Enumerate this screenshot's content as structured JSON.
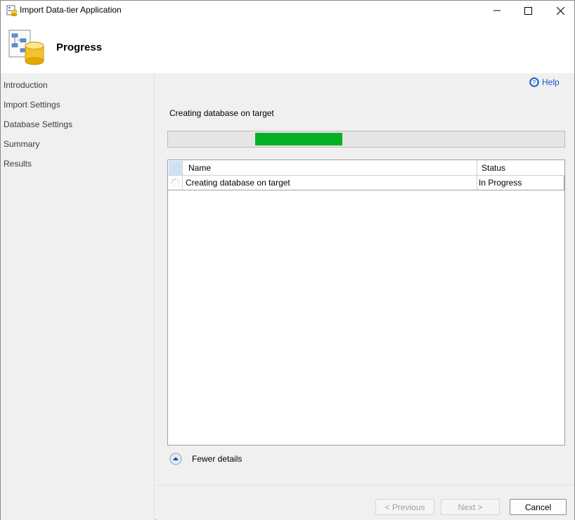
{
  "window": {
    "title": "Import Data-tier Application"
  },
  "header": {
    "title": "Progress"
  },
  "sidebar": {
    "items": [
      {
        "label": "Introduction"
      },
      {
        "label": "Import Settings"
      },
      {
        "label": "Database Settings"
      },
      {
        "label": "Summary"
      },
      {
        "label": "Results"
      }
    ]
  },
  "main": {
    "help_label": "Help",
    "status_text": "Creating database on target",
    "progress": {
      "fill_start_fraction": 0.22,
      "fill_end_fraction": 0.44,
      "color": "#06b025"
    },
    "grid": {
      "columns": [
        "Name",
        "Status"
      ],
      "rows": [
        {
          "name": "Creating database on target",
          "status": "In Progress"
        }
      ]
    },
    "details_toggle_label": "Fewer details"
  },
  "buttons": {
    "previous": "< Previous",
    "next": "Next >",
    "cancel": "Cancel"
  }
}
